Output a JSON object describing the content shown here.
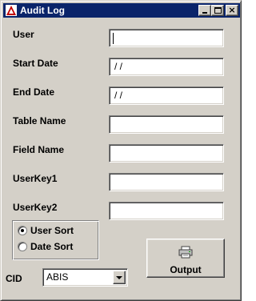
{
  "window": {
    "title": "Audit Log",
    "icon": "app-logo-icon",
    "title_bar_color": "#0a246a",
    "face_color": "#d4d0c8",
    "controls": {
      "minimize_icon": "minimize-icon",
      "maximize_icon": "maximize-icon",
      "close_icon": "close-icon",
      "close_glyph": "×"
    }
  },
  "form": {
    "user": {
      "label": "User",
      "value": ""
    },
    "start_date": {
      "label": "Start Date",
      "value": "/ /"
    },
    "end_date": {
      "label": "End Date",
      "value": "/ /"
    },
    "table_name": {
      "label": "Table Name",
      "value": ""
    },
    "field_name": {
      "label": "Field Name",
      "value": ""
    },
    "userkey1": {
      "label": "UserKey1",
      "value": ""
    },
    "userkey2": {
      "label": "UserKey2",
      "value": ""
    }
  },
  "sort": {
    "options": [
      {
        "label": "User Sort",
        "selected": true
      },
      {
        "label": "Date Sort",
        "selected": false
      }
    ]
  },
  "output_button": {
    "label": "Output",
    "icon": "printer-icon"
  },
  "cid": {
    "label": "CID",
    "selected": "ABIS"
  }
}
